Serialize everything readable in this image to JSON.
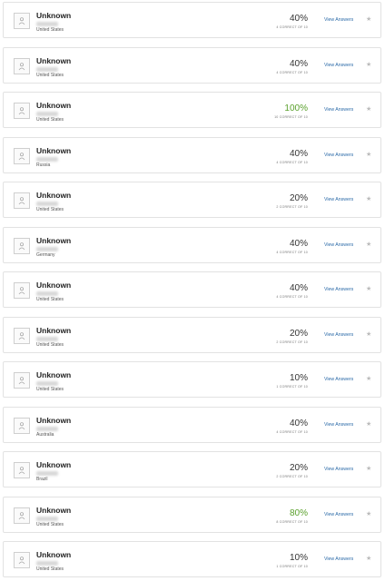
{
  "list": {
    "view_label": "View Answers",
    "star_icon": "star-icon",
    "colors": {
      "high_score": "#5aa02c",
      "link": "#2b6aa8"
    },
    "items": [
      {
        "name": "Unknown",
        "country": "United States",
        "score": "40%",
        "correct": "4 CORRECT OF 10"
      },
      {
        "name": "Unknown",
        "country": "United States",
        "score": "40%",
        "correct": "4 CORRECT OF 10"
      },
      {
        "name": "Unknown",
        "country": "United States",
        "score": "100%",
        "correct": "10 CORRECT OF 10",
        "highlight": true
      },
      {
        "name": "Unknown",
        "country": "Russia",
        "score": "40%",
        "correct": "4 CORRECT OF 10"
      },
      {
        "name": "Unknown",
        "country": "United States",
        "score": "20%",
        "correct": "2 CORRECT OF 10"
      },
      {
        "name": "Unknown",
        "country": "Germany",
        "score": "40%",
        "correct": "4 CORRECT OF 10"
      },
      {
        "name": "Unknown",
        "country": "United States",
        "score": "40%",
        "correct": "4 CORRECT OF 10"
      },
      {
        "name": "Unknown",
        "country": "United States",
        "score": "20%",
        "correct": "2 CORRECT OF 10"
      },
      {
        "name": "Unknown",
        "country": "United States",
        "score": "10%",
        "correct": "1 CORRECT OF 10"
      },
      {
        "name": "Unknown",
        "country": "Australia",
        "score": "40%",
        "correct": "4 CORRECT OF 10"
      },
      {
        "name": "Unknown",
        "country": "Brazil",
        "score": "20%",
        "correct": "2 CORRECT OF 10"
      },
      {
        "name": "Unknown",
        "country": "United States",
        "score": "80%",
        "correct": "8 CORRECT OF 10",
        "highlight": true
      },
      {
        "name": "Unknown",
        "country": "United States",
        "score": "10%",
        "correct": "1 CORRECT OF 10"
      }
    ]
  }
}
